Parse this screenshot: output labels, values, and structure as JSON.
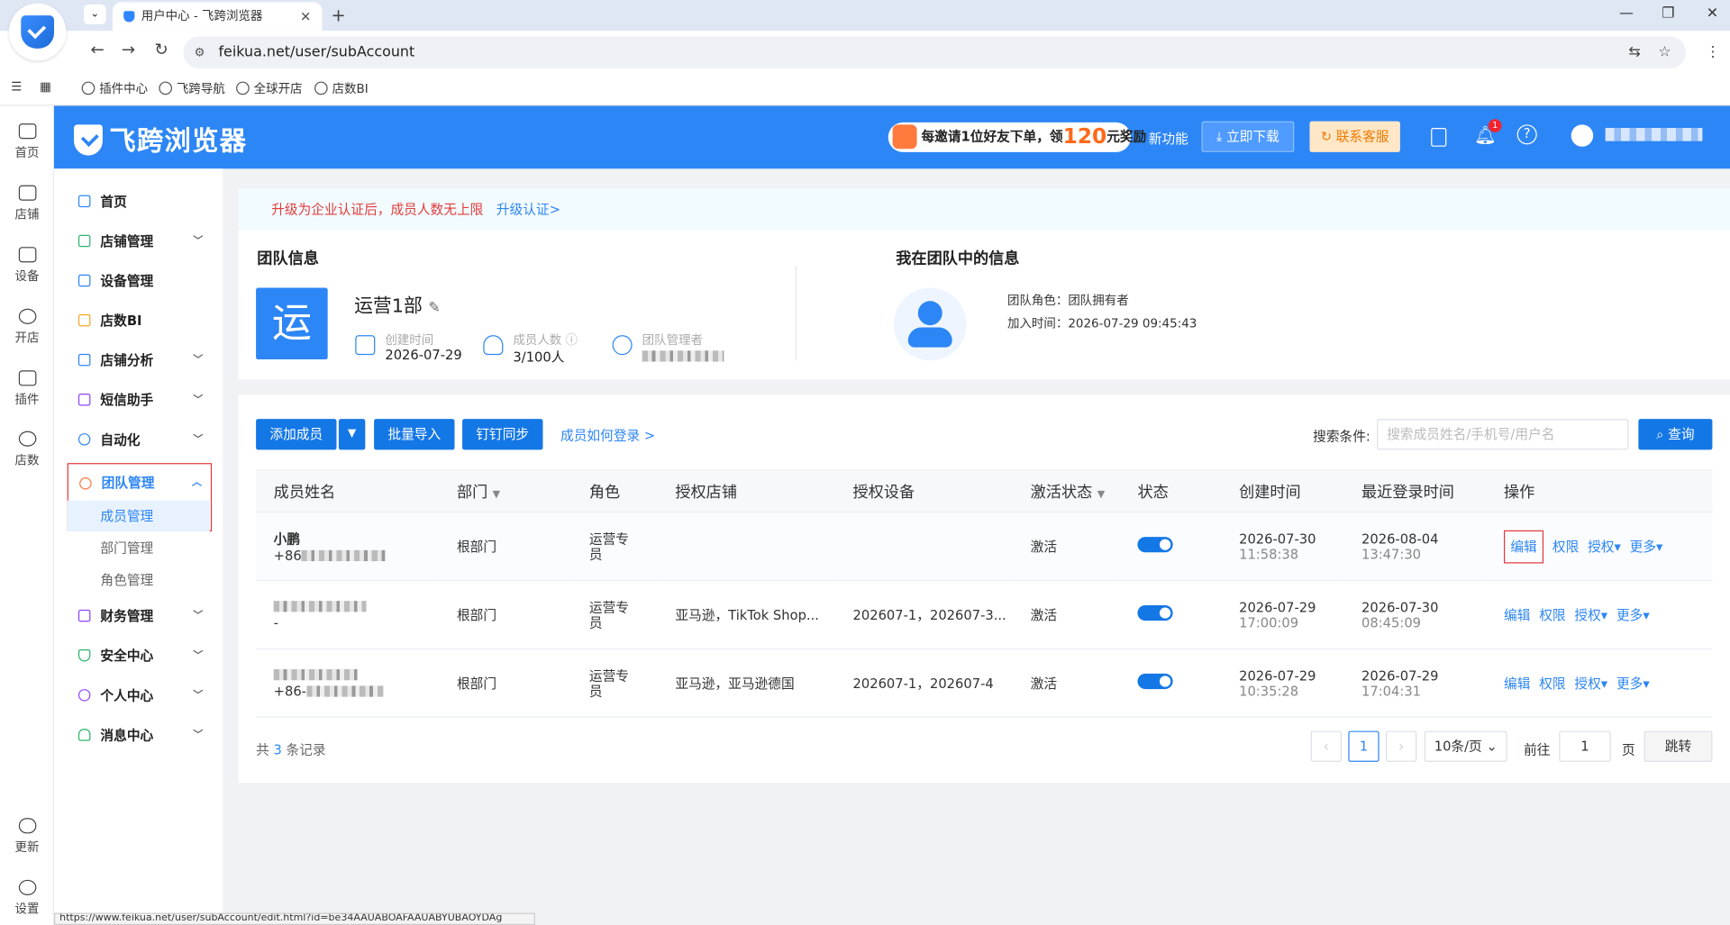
{
  "browser": {
    "tab_title": "用户中心 - 飞跨浏览器",
    "url": "feikua.net/user/subAccount",
    "bookmarks": [
      "插件中心",
      "飞跨导航",
      "全球开店",
      "店数BI"
    ],
    "status_url": "https://www.feikua.net/user/subAccount/edit.html?id=be34AAUABOAFAAUABYUBAOYDAg"
  },
  "rail": {
    "items": [
      "首页",
      "店铺",
      "设备",
      "开店",
      "插件",
      "店数"
    ],
    "bottom": [
      "更新",
      "设置"
    ]
  },
  "header": {
    "brand": "飞跨浏览器",
    "invite_prefix": "每邀请1位好友下单，领",
    "invite_amount": "120",
    "invite_suffix": "元奖励",
    "new_feature": "新功能",
    "download": "立即下载",
    "service": "联系客服",
    "badge": "1",
    "help": "?"
  },
  "sidebar": {
    "menus": [
      {
        "label": "首页"
      },
      {
        "label": "店铺管理"
      },
      {
        "label": "设备管理"
      },
      {
        "label": "店数BI"
      },
      {
        "label": "店铺分析"
      },
      {
        "label": "短信助手"
      },
      {
        "label": "自动化"
      },
      {
        "label": "团队管理"
      },
      {
        "label": "财务管理"
      },
      {
        "label": "安全中心"
      },
      {
        "label": "个人中心"
      },
      {
        "label": "消息中心"
      }
    ],
    "sub_items": [
      "成员管理",
      "部门管理",
      "角色管理"
    ]
  },
  "notice": {
    "text": "升级为企业认证后，成员人数无上限",
    "link": "升级认证>"
  },
  "team": {
    "title": "团队信息",
    "logo_char": "运",
    "name": "运营1部",
    "created_label": "创建时间",
    "created": "2026-07-29",
    "members_label": "成员人数",
    "members": "3/100人",
    "admin_label": "团队管理者",
    "my_title": "我在团队中的信息",
    "role_label": "团队角色：",
    "role": "团队拥有者",
    "join_label": "加入时间：",
    "join": "2026-07-29 09:45:43"
  },
  "toolbar": {
    "add": "添加成员",
    "dropdown": "▼",
    "import": "批量导入",
    "dingding": "钉钉同步",
    "howto": "成员如何登录 >",
    "search_label": "搜索条件:",
    "search_placeholder": "搜索成员姓名/手机号/用户名",
    "query": "查询"
  },
  "table": {
    "headers": [
      "成员姓名",
      "部门",
      "角色",
      "授权店铺",
      "授权设备",
      "激活状态",
      "状态",
      "创建时间",
      "最近登录时间",
      "操作"
    ],
    "rows": [
      {
        "name": "小鹏",
        "phone": "+86",
        "dept": "根部门",
        "role": "运营专员",
        "shops": "",
        "devices": "",
        "active": "激活",
        "created_date": "2026-07-30",
        "created_time": "11:58:38",
        "login_date": "2026-08-04",
        "login_time": "13:47:30"
      },
      {
        "name": "",
        "phone": "-",
        "dept": "根部门",
        "role": "运营专员",
        "shops": "亚马逊，TikTok Shop...",
        "devices": "202607-1，202607-3...",
        "active": "激活",
        "created_date": "2026-07-29",
        "created_time": "17:00:09",
        "login_date": "2026-07-30",
        "login_time": "08:45:09"
      },
      {
        "name": "",
        "phone": "+86-",
        "dept": "根部门",
        "role": "运营专员",
        "shops": "亚马逊，亚马逊德国",
        "devices": "202607-1，202607-4",
        "active": "激活",
        "created_date": "2026-07-29",
        "created_time": "10:35:28",
        "login_date": "2026-07-29",
        "login_time": "17:04:31"
      }
    ],
    "ops": [
      "编辑",
      "权限",
      "授权▾",
      "更多▾"
    ]
  },
  "pagination": {
    "total_prefix": "共",
    "total": "3",
    "total_suffix": "条记录",
    "current": "1",
    "page_size": "10条/页",
    "goto_label": "前往",
    "goto_value": "1",
    "page_unit": "页",
    "jump": "跳转"
  }
}
